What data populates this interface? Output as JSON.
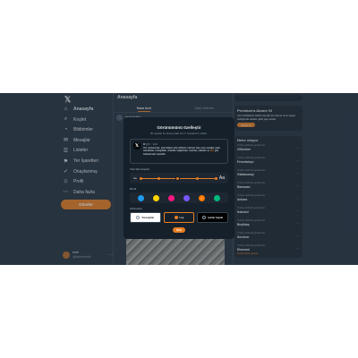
{
  "sidebar": {
    "logo": "𝕏",
    "items": [
      {
        "label": "Anasayfa",
        "icon": "home-icon",
        "glyph": "⌂",
        "active": true
      },
      {
        "label": "Keşfet",
        "icon": "search-icon",
        "glyph": "⌕"
      },
      {
        "label": "Bildirimler",
        "icon": "bell-icon",
        "glyph": "◔"
      },
      {
        "label": "Mesajlar",
        "icon": "mail-icon",
        "glyph": "✉"
      },
      {
        "label": "Listeler",
        "icon": "list-icon",
        "glyph": "☰"
      },
      {
        "label": "Yer İşaretleri",
        "icon": "bookmark-icon",
        "glyph": "⚑"
      },
      {
        "label": "Onaylanmış",
        "icon": "verified-icon",
        "glyph": "✓"
      },
      {
        "label": "Profil",
        "icon": "user-icon",
        "glyph": "☺"
      },
      {
        "label": "Daha fazla",
        "icon": "more-icon",
        "glyph": "⋯"
      }
    ],
    "post_button": "Gönder",
    "account": {
      "name": "emir",
      "handle": "@fakehandle"
    }
  },
  "main": {
    "title": "Anasayfa",
    "tabs": [
      {
        "label": "Sana özel"
      },
      {
        "label": "Takip edilenler"
      }
    ],
    "feed_name": "seriuslyklyl"
  },
  "right": {
    "premium": {
      "title": "Premium'a Abone Ol",
      "text": "Yeni özelliklerin kilidini açmak için abone ol ve uygun olduğunda reklam geliri payı kazan.",
      "button": "Abone ol"
    },
    "trends_title": "Neler oluyor",
    "trends": [
      {
        "meta": "Türkiye tarihinde gündemde",
        "name": "#Gündem"
      },
      {
        "meta": "Türkiye tarihinde gündemde",
        "name": "Fenerbahçe"
      },
      {
        "meta": "Türkiye tarihinde gündemde",
        "name": "Galatasaray"
      },
      {
        "meta": "Türkiye tarihinde gündemde",
        "name": "Ramazan"
      },
      {
        "meta": "Türkiye tarihinde gündemde",
        "name": "Ankara"
      },
      {
        "meta": "Türkiye tarihinde gündemde",
        "name": "İstanbul"
      },
      {
        "meta": "Türkiye tarihinde gündemde",
        "name": "Beşiktaş"
      },
      {
        "meta": "Türkiye tarihinde gündemde",
        "name": "Survivor"
      },
      {
        "meta": "Türkiye tarihinde gündemde",
        "name": "Ekonomi"
      }
    ],
    "show_more": "Daha fazla göster"
  },
  "modal": {
    "title": "Görünümünü özelleştir",
    "subtitle": "Bu ayarlar bu tarayıcıdaki tüm X hesaplarını etkiler.",
    "preview": {
      "logo": "𝕏",
      "name": "X",
      "handle": "@X · 10d",
      "text_before": "X'in merkezinde, tıpkı kitabın gibi sohbetin merkezi olan ana mesajlar yatar. Gönderiler, Fotoğraflar, videolar, bağlantılar, metinler, etiketler ve ",
      "link": "@X",
      "text_after": " gibi bahsetmeler içerebilir."
    },
    "font_size_label": "Yazı tipi boyutu",
    "font_size_small": "Aa",
    "font_size_large": "Aa",
    "font_size_level": 0.5,
    "color_label": "Renk",
    "colors": [
      "#1d9bf0",
      "#ffd400",
      "#f91880",
      "#7856ff",
      "#ff7a00",
      "#00ba7c"
    ],
    "selected_color": 4,
    "background_label": "Arka plan",
    "backgrounds": [
      {
        "label": "Varsayılan",
        "bg": "#ffffff",
        "fg": "#0f1419"
      },
      {
        "label": "Loş",
        "bg": "#15202b",
        "fg": "#e7e9ea",
        "selected": true
      },
      {
        "label": "Işıklar kapalı",
        "bg": "#000000",
        "fg": "#e7e9ea"
      }
    ],
    "done_button": "Bitti"
  }
}
